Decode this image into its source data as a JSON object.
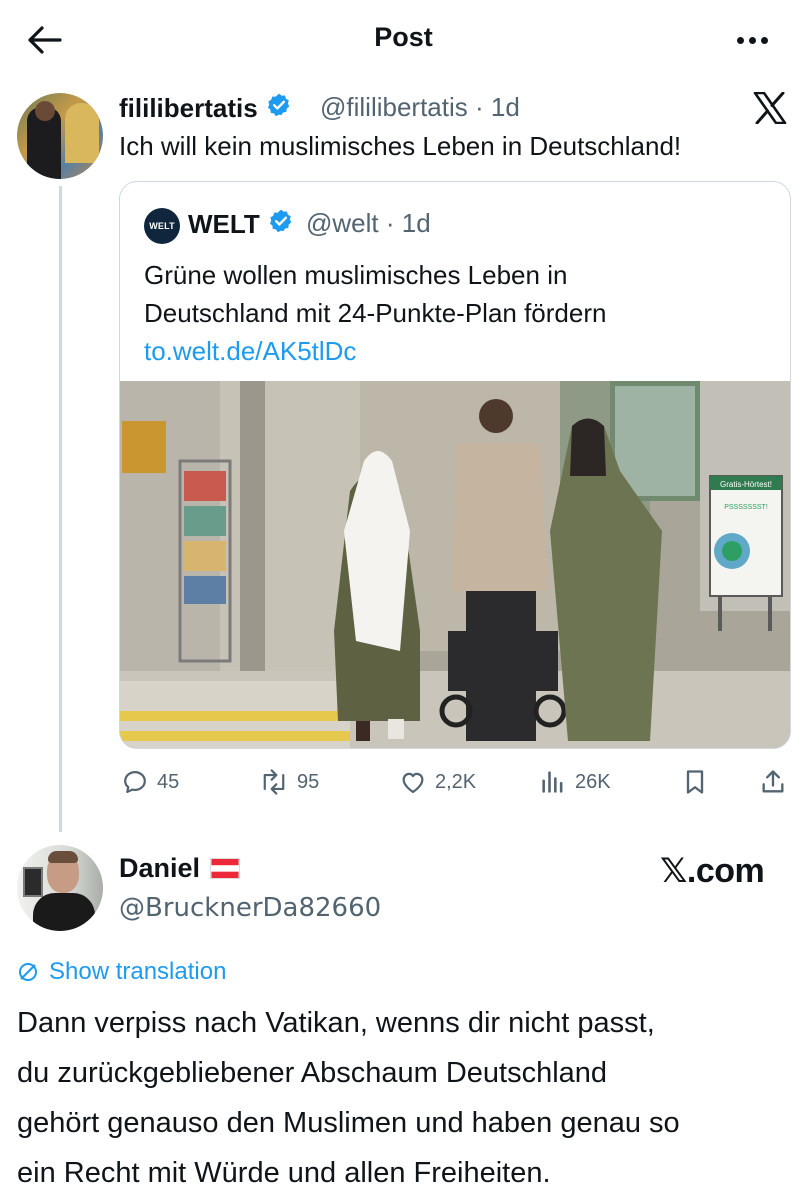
{
  "header": {
    "title": "Post"
  },
  "tweet": {
    "display_name": "fililibertatis",
    "handle": "@fililibertatis",
    "time": "1d",
    "text": "Ich will kein muslimisches Leben in Deutschland!",
    "stats": {
      "replies": "45",
      "reposts": "95",
      "likes": "2,2K",
      "views": "26K"
    }
  },
  "quote": {
    "avatar_text": "WELT",
    "display_name": "WELT",
    "handle": "@welt",
    "time": "1d",
    "text_lines": [
      "Grüne wollen muslimisches Leben in",
      "Deutschland mit 24-Punkte-Plan fördern"
    ],
    "link": "to.welt.de/AK5tlDc",
    "image_sign": {
      "title": "Gratis-Hörtest!",
      "text": "PSSSSSSST!"
    }
  },
  "reply": {
    "display_name": "Daniel",
    "handle": "@BrucknerDa82660",
    "brand": "𝕏.com",
    "show_translation": "Show translation",
    "text_lines": [
      "Dann verpiss nach Vatikan, wenns dir nicht passt,",
      "du zurückgebliebener Abschaum Deutschland",
      "gehört genauso den Muslimen und haben genau so",
      "ein Recht mit Würde und allen Freiheiten."
    ]
  },
  "colors": {
    "text": "#0f1419",
    "secondary": "#536471",
    "link": "#1d9bf0",
    "border": "#cfd9de",
    "verified": "#1d9bf0"
  }
}
